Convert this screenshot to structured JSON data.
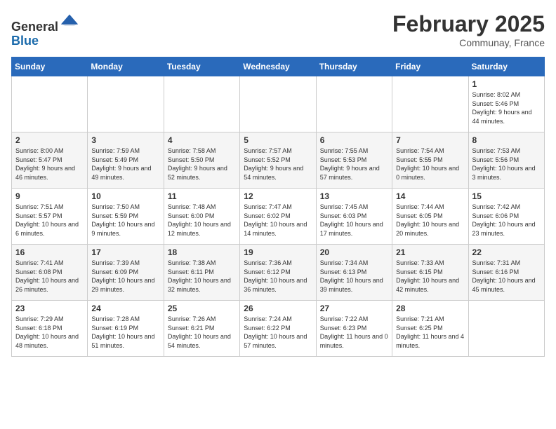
{
  "header": {
    "logo_line1": "General",
    "logo_line2": "Blue",
    "month_title": "February 2025",
    "location": "Communay, France"
  },
  "days_of_week": [
    "Sunday",
    "Monday",
    "Tuesday",
    "Wednesday",
    "Thursday",
    "Friday",
    "Saturday"
  ],
  "weeks": [
    {
      "days": [
        {
          "num": "",
          "info": ""
        },
        {
          "num": "",
          "info": ""
        },
        {
          "num": "",
          "info": ""
        },
        {
          "num": "",
          "info": ""
        },
        {
          "num": "",
          "info": ""
        },
        {
          "num": "",
          "info": ""
        },
        {
          "num": "1",
          "info": "Sunrise: 8:02 AM\nSunset: 5:46 PM\nDaylight: 9 hours and 44 minutes."
        }
      ]
    },
    {
      "days": [
        {
          "num": "2",
          "info": "Sunrise: 8:00 AM\nSunset: 5:47 PM\nDaylight: 9 hours and 46 minutes."
        },
        {
          "num": "3",
          "info": "Sunrise: 7:59 AM\nSunset: 5:49 PM\nDaylight: 9 hours and 49 minutes."
        },
        {
          "num": "4",
          "info": "Sunrise: 7:58 AM\nSunset: 5:50 PM\nDaylight: 9 hours and 52 minutes."
        },
        {
          "num": "5",
          "info": "Sunrise: 7:57 AM\nSunset: 5:52 PM\nDaylight: 9 hours and 54 minutes."
        },
        {
          "num": "6",
          "info": "Sunrise: 7:55 AM\nSunset: 5:53 PM\nDaylight: 9 hours and 57 minutes."
        },
        {
          "num": "7",
          "info": "Sunrise: 7:54 AM\nSunset: 5:55 PM\nDaylight: 10 hours and 0 minutes."
        },
        {
          "num": "8",
          "info": "Sunrise: 7:53 AM\nSunset: 5:56 PM\nDaylight: 10 hours and 3 minutes."
        }
      ]
    },
    {
      "days": [
        {
          "num": "9",
          "info": "Sunrise: 7:51 AM\nSunset: 5:57 PM\nDaylight: 10 hours and 6 minutes."
        },
        {
          "num": "10",
          "info": "Sunrise: 7:50 AM\nSunset: 5:59 PM\nDaylight: 10 hours and 9 minutes."
        },
        {
          "num": "11",
          "info": "Sunrise: 7:48 AM\nSunset: 6:00 PM\nDaylight: 10 hours and 12 minutes."
        },
        {
          "num": "12",
          "info": "Sunrise: 7:47 AM\nSunset: 6:02 PM\nDaylight: 10 hours and 14 minutes."
        },
        {
          "num": "13",
          "info": "Sunrise: 7:45 AM\nSunset: 6:03 PM\nDaylight: 10 hours and 17 minutes."
        },
        {
          "num": "14",
          "info": "Sunrise: 7:44 AM\nSunset: 6:05 PM\nDaylight: 10 hours and 20 minutes."
        },
        {
          "num": "15",
          "info": "Sunrise: 7:42 AM\nSunset: 6:06 PM\nDaylight: 10 hours and 23 minutes."
        }
      ]
    },
    {
      "days": [
        {
          "num": "16",
          "info": "Sunrise: 7:41 AM\nSunset: 6:08 PM\nDaylight: 10 hours and 26 minutes."
        },
        {
          "num": "17",
          "info": "Sunrise: 7:39 AM\nSunset: 6:09 PM\nDaylight: 10 hours and 29 minutes."
        },
        {
          "num": "18",
          "info": "Sunrise: 7:38 AM\nSunset: 6:11 PM\nDaylight: 10 hours and 32 minutes."
        },
        {
          "num": "19",
          "info": "Sunrise: 7:36 AM\nSunset: 6:12 PM\nDaylight: 10 hours and 36 minutes."
        },
        {
          "num": "20",
          "info": "Sunrise: 7:34 AM\nSunset: 6:13 PM\nDaylight: 10 hours and 39 minutes."
        },
        {
          "num": "21",
          "info": "Sunrise: 7:33 AM\nSunset: 6:15 PM\nDaylight: 10 hours and 42 minutes."
        },
        {
          "num": "22",
          "info": "Sunrise: 7:31 AM\nSunset: 6:16 PM\nDaylight: 10 hours and 45 minutes."
        }
      ]
    },
    {
      "days": [
        {
          "num": "23",
          "info": "Sunrise: 7:29 AM\nSunset: 6:18 PM\nDaylight: 10 hours and 48 minutes."
        },
        {
          "num": "24",
          "info": "Sunrise: 7:28 AM\nSunset: 6:19 PM\nDaylight: 10 hours and 51 minutes."
        },
        {
          "num": "25",
          "info": "Sunrise: 7:26 AM\nSunset: 6:21 PM\nDaylight: 10 hours and 54 minutes."
        },
        {
          "num": "26",
          "info": "Sunrise: 7:24 AM\nSunset: 6:22 PM\nDaylight: 10 hours and 57 minutes."
        },
        {
          "num": "27",
          "info": "Sunrise: 7:22 AM\nSunset: 6:23 PM\nDaylight: 11 hours and 0 minutes."
        },
        {
          "num": "28",
          "info": "Sunrise: 7:21 AM\nSunset: 6:25 PM\nDaylight: 11 hours and 4 minutes."
        },
        {
          "num": "",
          "info": ""
        }
      ]
    }
  ]
}
